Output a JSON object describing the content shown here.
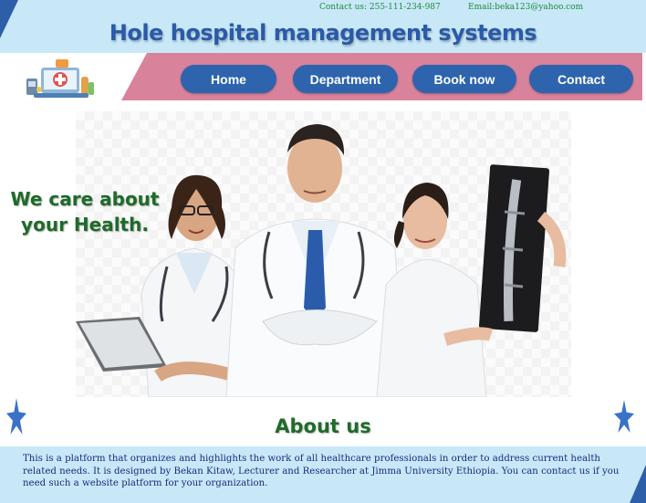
{
  "header": {
    "contact_phone": "Contact us: 255-111-234-987",
    "contact_email": "Email:beka123@yahoo.com",
    "site_title": "Hole hospital management systems"
  },
  "nav": {
    "items": [
      {
        "label": "Home"
      },
      {
        "label": "Department"
      },
      {
        "label": "Book now"
      },
      {
        "label": "Contact"
      }
    ]
  },
  "hero": {
    "tagline_line1": "We care about",
    "tagline_line2": "your Health."
  },
  "about": {
    "title": "About us",
    "body": "This is a platform that organizes and highlights the work of all healthcare professionals in order to address current health related needs. It is designed by Bekan Kitaw, Lecturer and Researcher at Jimma University Ethiopia. You can contact us if you need such a website platform for your organization."
  },
  "colors": {
    "header_bg": "#c8e8f8",
    "nav_band": "#d9829c",
    "nav_button": "#2d64ad",
    "title_blue": "#2a5aa8",
    "accent_green": "#1e6b2a"
  },
  "icons": [
    "hospital-logo-icon",
    "star-icon"
  ]
}
